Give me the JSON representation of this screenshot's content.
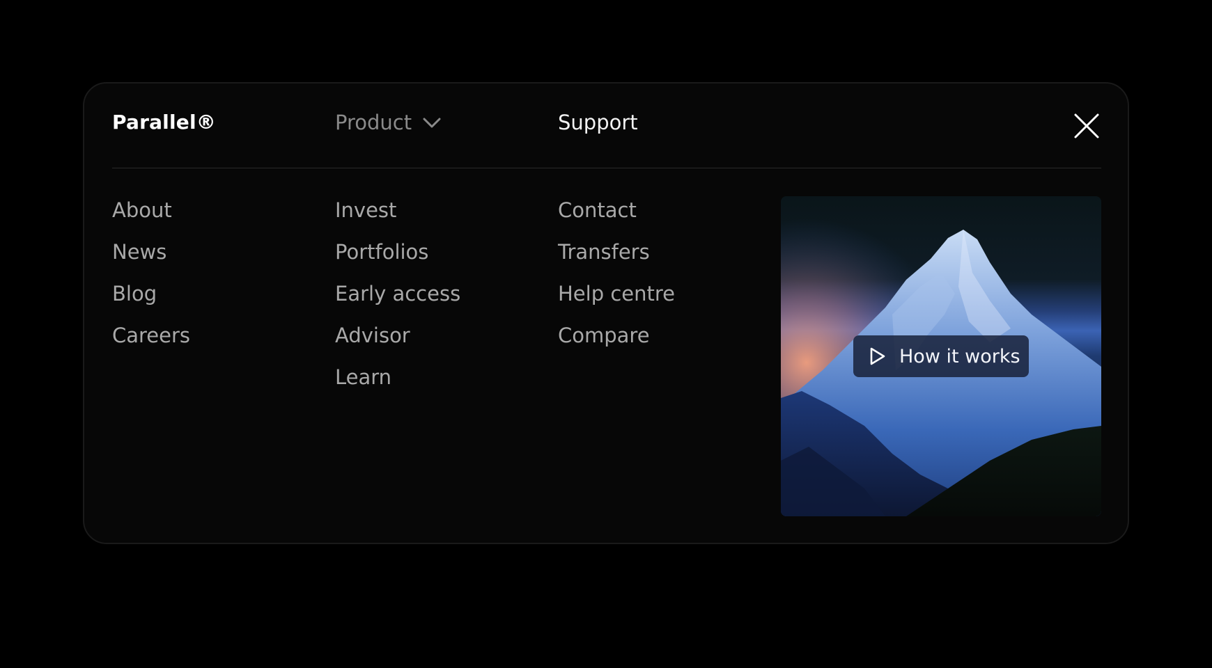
{
  "brand": {
    "name": "Parallel®"
  },
  "nav": {
    "product_label": "Product",
    "support_label": "Support"
  },
  "icons": {
    "product_toggle": "chevron-down-icon",
    "close": "close-icon",
    "play": "play-icon"
  },
  "columns": {
    "company": [
      "About",
      "News",
      "Blog",
      "Careers"
    ],
    "product": [
      "Invest",
      "Portfolios",
      "Early access",
      "Advisor",
      "Learn"
    ],
    "support": [
      "Contact",
      "Transfers",
      "Help centre",
      "Compare"
    ]
  },
  "promo": {
    "button_label": "How it works"
  },
  "colors": {
    "page_background": "#000000",
    "panel_background": "#070707",
    "link_text": "#a9a9a9",
    "active_text": "#f2f2f2",
    "muted_text": "#8a8a8a"
  }
}
